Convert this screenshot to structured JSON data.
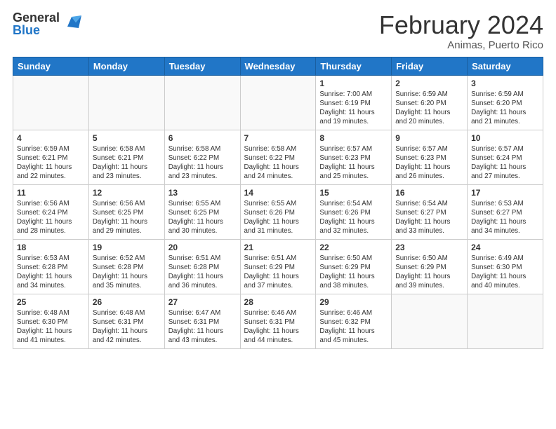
{
  "logo": {
    "general": "General",
    "blue": "Blue"
  },
  "header": {
    "month_year": "February 2024",
    "location": "Animas, Puerto Rico"
  },
  "weekdays": [
    "Sunday",
    "Monday",
    "Tuesday",
    "Wednesday",
    "Thursday",
    "Friday",
    "Saturday"
  ],
  "weeks": [
    [
      {
        "day": "",
        "info": ""
      },
      {
        "day": "",
        "info": ""
      },
      {
        "day": "",
        "info": ""
      },
      {
        "day": "",
        "info": ""
      },
      {
        "day": "1",
        "info": "Sunrise: 7:00 AM\nSunset: 6:19 PM\nDaylight: 11 hours\nand 19 minutes."
      },
      {
        "day": "2",
        "info": "Sunrise: 6:59 AM\nSunset: 6:20 PM\nDaylight: 11 hours\nand 20 minutes."
      },
      {
        "day": "3",
        "info": "Sunrise: 6:59 AM\nSunset: 6:20 PM\nDaylight: 11 hours\nand 21 minutes."
      }
    ],
    [
      {
        "day": "4",
        "info": "Sunrise: 6:59 AM\nSunset: 6:21 PM\nDaylight: 11 hours\nand 22 minutes."
      },
      {
        "day": "5",
        "info": "Sunrise: 6:58 AM\nSunset: 6:21 PM\nDaylight: 11 hours\nand 23 minutes."
      },
      {
        "day": "6",
        "info": "Sunrise: 6:58 AM\nSunset: 6:22 PM\nDaylight: 11 hours\nand 23 minutes."
      },
      {
        "day": "7",
        "info": "Sunrise: 6:58 AM\nSunset: 6:22 PM\nDaylight: 11 hours\nand 24 minutes."
      },
      {
        "day": "8",
        "info": "Sunrise: 6:57 AM\nSunset: 6:23 PM\nDaylight: 11 hours\nand 25 minutes."
      },
      {
        "day": "9",
        "info": "Sunrise: 6:57 AM\nSunset: 6:23 PM\nDaylight: 11 hours\nand 26 minutes."
      },
      {
        "day": "10",
        "info": "Sunrise: 6:57 AM\nSunset: 6:24 PM\nDaylight: 11 hours\nand 27 minutes."
      }
    ],
    [
      {
        "day": "11",
        "info": "Sunrise: 6:56 AM\nSunset: 6:24 PM\nDaylight: 11 hours\nand 28 minutes."
      },
      {
        "day": "12",
        "info": "Sunrise: 6:56 AM\nSunset: 6:25 PM\nDaylight: 11 hours\nand 29 minutes."
      },
      {
        "day": "13",
        "info": "Sunrise: 6:55 AM\nSunset: 6:25 PM\nDaylight: 11 hours\nand 30 minutes."
      },
      {
        "day": "14",
        "info": "Sunrise: 6:55 AM\nSunset: 6:26 PM\nDaylight: 11 hours\nand 31 minutes."
      },
      {
        "day": "15",
        "info": "Sunrise: 6:54 AM\nSunset: 6:26 PM\nDaylight: 11 hours\nand 32 minutes."
      },
      {
        "day": "16",
        "info": "Sunrise: 6:54 AM\nSunset: 6:27 PM\nDaylight: 11 hours\nand 33 minutes."
      },
      {
        "day": "17",
        "info": "Sunrise: 6:53 AM\nSunset: 6:27 PM\nDaylight: 11 hours\nand 34 minutes."
      }
    ],
    [
      {
        "day": "18",
        "info": "Sunrise: 6:53 AM\nSunset: 6:28 PM\nDaylight: 11 hours\nand 34 minutes."
      },
      {
        "day": "19",
        "info": "Sunrise: 6:52 AM\nSunset: 6:28 PM\nDaylight: 11 hours\nand 35 minutes."
      },
      {
        "day": "20",
        "info": "Sunrise: 6:51 AM\nSunset: 6:28 PM\nDaylight: 11 hours\nand 36 minutes."
      },
      {
        "day": "21",
        "info": "Sunrise: 6:51 AM\nSunset: 6:29 PM\nDaylight: 11 hours\nand 37 minutes."
      },
      {
        "day": "22",
        "info": "Sunrise: 6:50 AM\nSunset: 6:29 PM\nDaylight: 11 hours\nand 38 minutes."
      },
      {
        "day": "23",
        "info": "Sunrise: 6:50 AM\nSunset: 6:29 PM\nDaylight: 11 hours\nand 39 minutes."
      },
      {
        "day": "24",
        "info": "Sunrise: 6:49 AM\nSunset: 6:30 PM\nDaylight: 11 hours\nand 40 minutes."
      }
    ],
    [
      {
        "day": "25",
        "info": "Sunrise: 6:48 AM\nSunset: 6:30 PM\nDaylight: 11 hours\nand 41 minutes."
      },
      {
        "day": "26",
        "info": "Sunrise: 6:48 AM\nSunset: 6:31 PM\nDaylight: 11 hours\nand 42 minutes."
      },
      {
        "day": "27",
        "info": "Sunrise: 6:47 AM\nSunset: 6:31 PM\nDaylight: 11 hours\nand 43 minutes."
      },
      {
        "day": "28",
        "info": "Sunrise: 6:46 AM\nSunset: 6:31 PM\nDaylight: 11 hours\nand 44 minutes."
      },
      {
        "day": "29",
        "info": "Sunrise: 6:46 AM\nSunset: 6:32 PM\nDaylight: 11 hours\nand 45 minutes."
      },
      {
        "day": "",
        "info": ""
      },
      {
        "day": "",
        "info": ""
      }
    ]
  ]
}
